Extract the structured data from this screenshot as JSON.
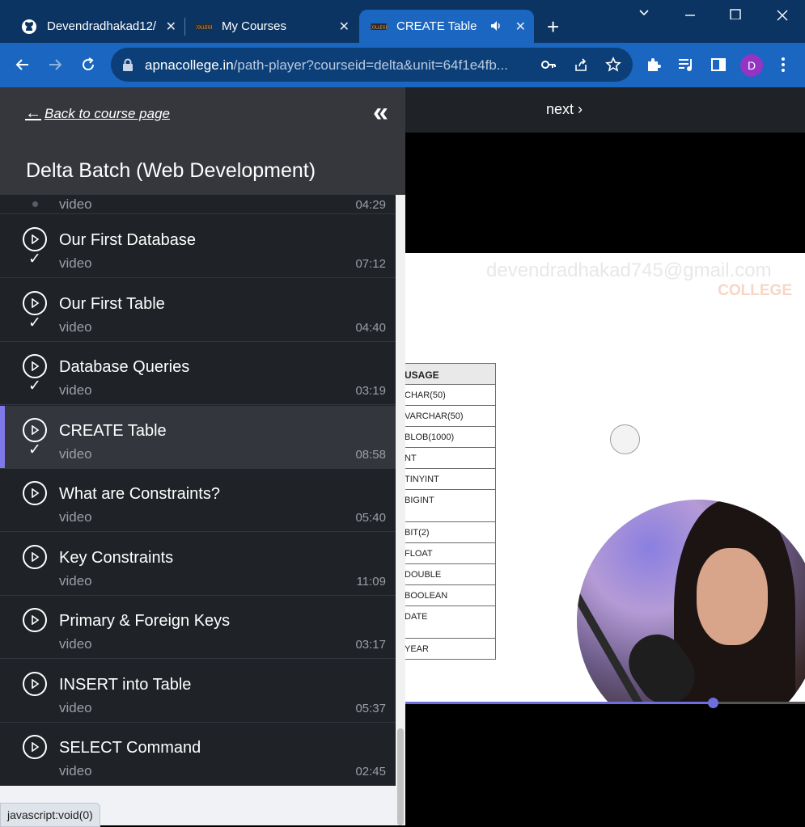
{
  "browser": {
    "tabs": [
      {
        "title": "Devendradhakad12/",
        "icon": "github-icon"
      },
      {
        "title": "My Courses",
        "icon": "apna-college-icon"
      },
      {
        "title": "CREATE Table",
        "icon": "apna-college-icon",
        "active": true,
        "audio": true
      }
    ],
    "url_host": "apnacollege.in",
    "url_rest": "/path-player?courseid=delta&unit=64f1e4fb...",
    "avatar_letter": "D",
    "status_text": "javascript:void(0)"
  },
  "sidebar": {
    "back_label": "Back to course page",
    "course_title": "Delta Batch (Web Development)",
    "partial_item": {
      "kind": "video",
      "duration": "04:29"
    },
    "items": [
      {
        "name": "Our First Database",
        "kind": "video",
        "duration": "07:12",
        "completed": true
      },
      {
        "name": "Our First Table",
        "kind": "video",
        "duration": "04:40",
        "completed": true
      },
      {
        "name": "Database Queries",
        "kind": "video",
        "duration": "03:19",
        "completed": true
      },
      {
        "name": "CREATE Table",
        "kind": "video",
        "duration": "08:58",
        "completed": true,
        "active": true
      },
      {
        "name": "What are Constraints?",
        "kind": "video",
        "duration": "05:40",
        "completed": false
      },
      {
        "name": "Key Constraints",
        "kind": "video",
        "duration": "11:09",
        "completed": false
      },
      {
        "name": "Primary & Foreign Keys",
        "kind": "video",
        "duration": "03:17",
        "completed": false
      },
      {
        "name": "INSERT into Table",
        "kind": "video",
        "duration": "05:37",
        "completed": false
      },
      {
        "name": "SELECT Command",
        "kind": "video",
        "duration": "02:45",
        "completed": false
      }
    ]
  },
  "player": {
    "next_label": "next",
    "watermark": "devendradhakad745@gmail.com",
    "brand": "COLLEGE",
    "table_header": "USAGE",
    "table_rows": [
      "CHAR(50)",
      "VARCHAR(50)",
      "BLOB(1000)",
      "NT",
      "TINYINT",
      "BIGINT",
      "BIT(2)",
      "FLOAT",
      "DOUBLE",
      "BOOLEAN",
      "DATE",
      "YEAR"
    ],
    "progress_fraction": 0.77
  },
  "colors": {
    "accent": "#7e78e8",
    "tab_active": "#1a66c0",
    "sidebar_bg": "#1f2227"
  }
}
